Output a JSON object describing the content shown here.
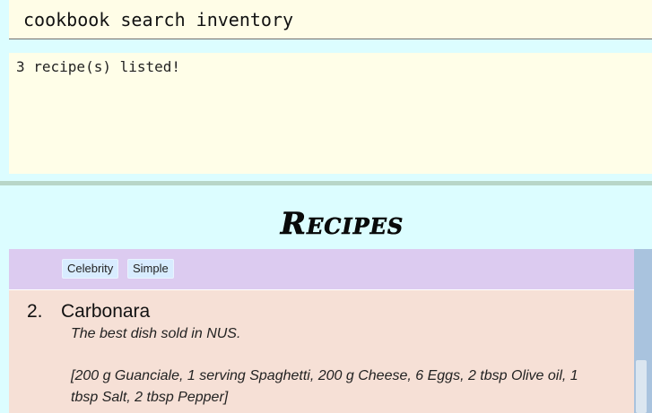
{
  "command": {
    "input_value": "cookbook search inventory"
  },
  "result": {
    "message": "3 recipe(s) listed!"
  },
  "panel": {
    "title": "Recipes"
  },
  "recipe_list": {
    "previous_card_tags": [
      "Celebrity",
      "Simple"
    ],
    "visible_card": {
      "index": "2.",
      "name": "Carbonara",
      "description": "The best dish sold in NUS.",
      "ingredients": "[200 g Guanciale, 1 serving Spaghetti, 200 g Cheese, 6 Eggs, 2 tbsp Olive oil, 1 tbsp Salt, 2 tbsp Pepper]"
    }
  },
  "colors": {
    "background": "#dcfdff",
    "command_box": "#fffde7",
    "tags_row": "#dccbf0",
    "card": "#f6e0d6",
    "tag": "#d8ecff",
    "scrollbar_track": "#a9c3de"
  }
}
